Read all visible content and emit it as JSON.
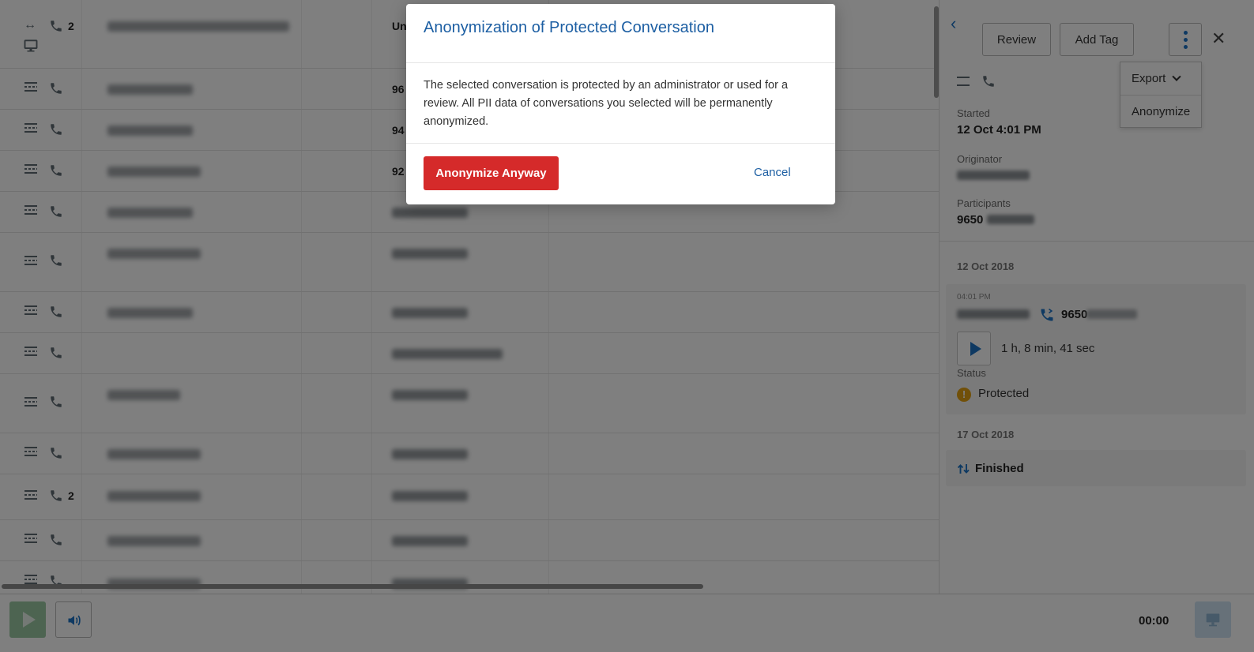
{
  "list": {
    "rows": [
      {
        "count": "2",
        "number": "Un"
      },
      {
        "count": "",
        "number": "96"
      },
      {
        "count": "",
        "number": "94"
      },
      {
        "count": "",
        "number": "92"
      },
      {
        "count": "",
        "number": ""
      },
      {
        "count": "",
        "number": ""
      },
      {
        "count": "",
        "number": ""
      },
      {
        "count": "",
        "number": ""
      },
      {
        "count": "",
        "number": ""
      },
      {
        "count": "",
        "number": ""
      },
      {
        "count": "2",
        "number": ""
      },
      {
        "count": "",
        "number": ""
      },
      {
        "count": "",
        "number": ""
      }
    ]
  },
  "panel": {
    "review_label": "Review",
    "add_tag_label": "Add Tag",
    "menu": {
      "export_label": "Export",
      "anonymize_label": "Anonymize"
    },
    "started_label": "Started",
    "started_value": "12 Oct 4:01 PM",
    "originator_label": "Originator",
    "participants_label": "Participants",
    "participants_value": "9650",
    "date1": "12 Oct 2018",
    "event_time": "04:01 PM",
    "event_number": "9650",
    "duration": "1 h, 8 min, 41 sec",
    "status_label": "Status",
    "status_value": "Protected",
    "date2": "17 Oct 2018",
    "finished_label": "Finished"
  },
  "player": {
    "time": "00:00"
  },
  "modal": {
    "title": "Anonymization of Protected Conversation",
    "body": "The selected conversation is protected by an administrator or used for a review. All PII data of conversations you selected will be permanently anonymized.",
    "confirm_label": "Anonymize Anyway",
    "cancel_label": "Cancel"
  },
  "colors": {
    "accent": "#1c73c5",
    "danger": "#d52a2a",
    "warning": "#e3a112"
  }
}
